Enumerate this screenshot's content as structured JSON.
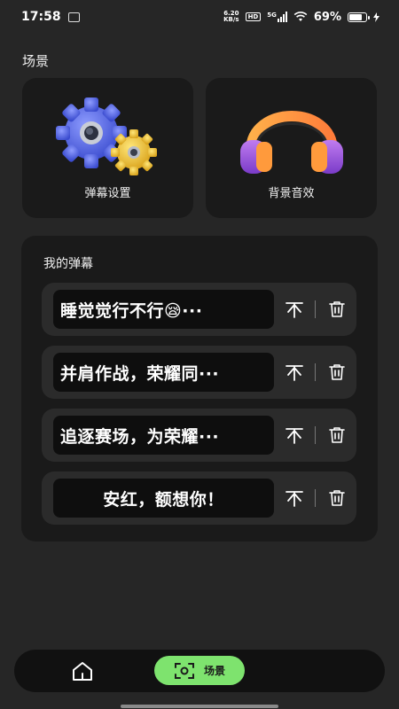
{
  "status_bar": {
    "time": "17:58",
    "net_speed_value": "6.20",
    "net_speed_unit": "KB/s",
    "hd": "HD",
    "network": "5G",
    "battery": "69%",
    "battery_level": 0.69
  },
  "section_title": "场景",
  "cards": {
    "danmu_settings": "弹幕设置",
    "background_sound": "背景音效"
  },
  "my_danmu": {
    "title": "我的弹幕",
    "items": [
      {
        "text": "睡觉觉行不行😪···"
      },
      {
        "text": "并肩作战，荣耀同···"
      },
      {
        "text": "追逐赛场，为荣耀···"
      },
      {
        "text": "安红，额想你！"
      }
    ]
  },
  "tabbar": {
    "home_icon": "home-icon",
    "scene_label": "场景",
    "scene_icon": "scan-icon"
  },
  "colors": {
    "background": "#262626",
    "card": "#1a1a1a",
    "accent": "#7ee36e"
  }
}
